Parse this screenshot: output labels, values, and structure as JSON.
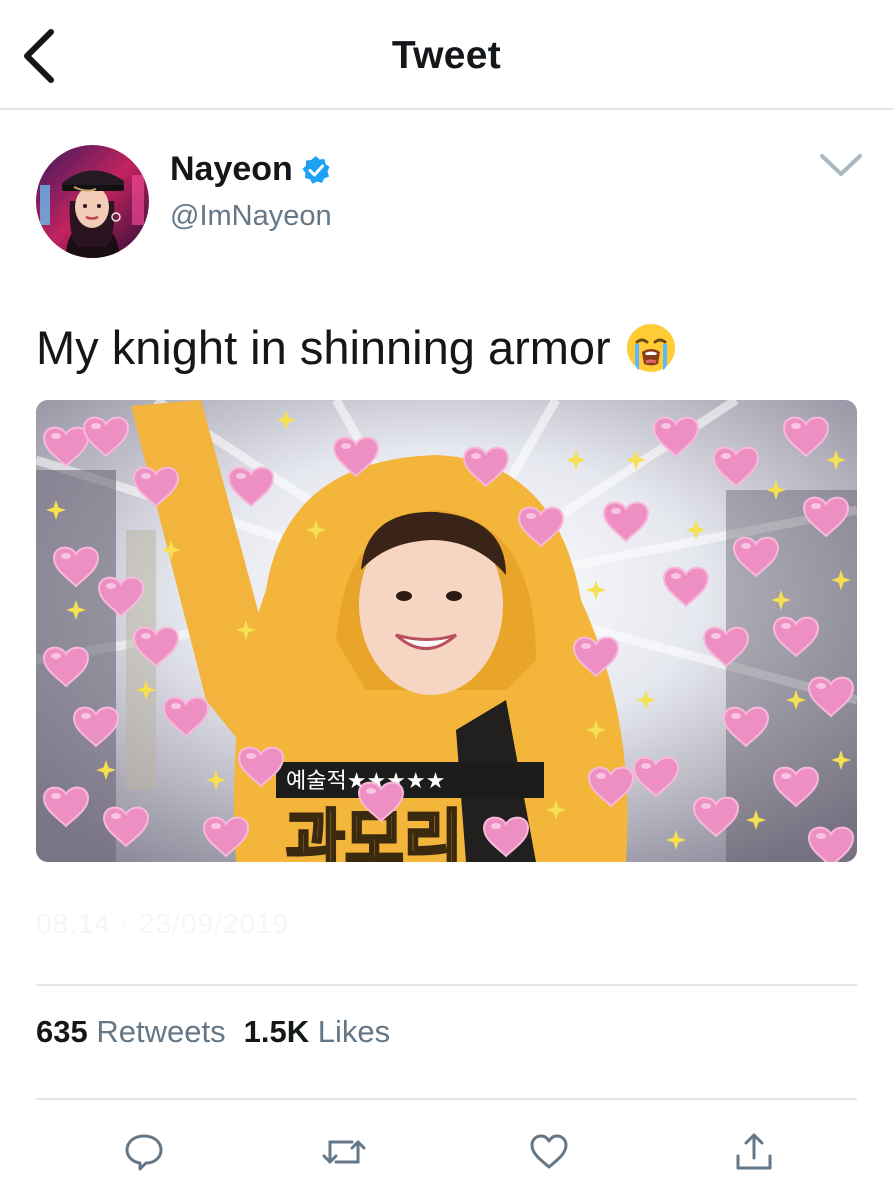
{
  "header": {
    "title": "Tweet",
    "back_icon": "chevron-left-icon"
  },
  "author": {
    "name": "Nayeon",
    "handle": "@ImNayeon",
    "verified": true,
    "verified_color": "#1da1f2"
  },
  "tweet": {
    "text": "My knight in shinning armor",
    "emoji": "loudly-crying-face",
    "timestamp": "08:14 · 23/09/2019",
    "media": {
      "caption_top": "예술적★★★★★",
      "caption_main": "과모리",
      "dominant_colors": [
        "#f0b33a",
        "#e87fb3",
        "#f5e050"
      ]
    }
  },
  "stats": {
    "retweets_count": "635",
    "retweets_label": "Retweets",
    "likes_count": "1.5K",
    "likes_label": "Likes"
  },
  "actions": [
    "reply-icon",
    "retweet-icon",
    "like-icon",
    "share-icon"
  ],
  "colors": {
    "text": "#14171a",
    "secondary": "#657786",
    "divider": "#e1e8ed",
    "accent": "#1da1f2"
  }
}
